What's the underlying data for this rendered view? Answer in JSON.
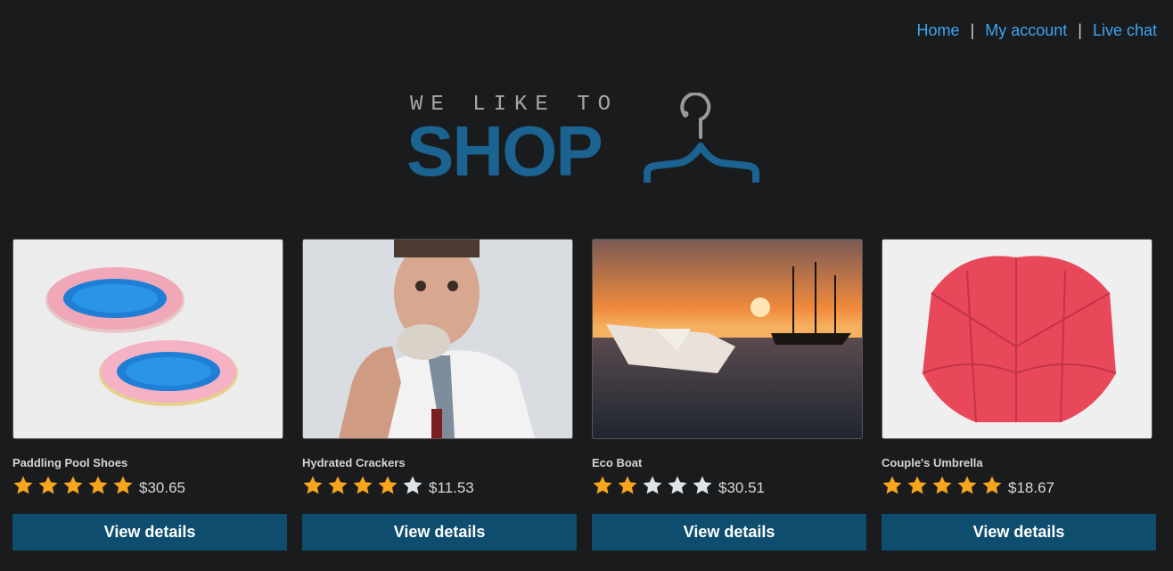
{
  "nav": {
    "home": "Home",
    "account": "My account",
    "chat": "Live chat",
    "sep": "|"
  },
  "logo": {
    "tagline": "WE LIKE TO",
    "word": "SHOP",
    "icon": "hanger-icon"
  },
  "colors": {
    "background": "#1a1b1d",
    "link": "#3da5f0",
    "button": "#0e4d6e",
    "brand": "#1b6391",
    "star_filled": "#f6a51c",
    "star_empty": "#dfe4e8"
  },
  "products": [
    {
      "name": "Paddling Pool Shoes",
      "rating": 5,
      "price": "$30.65",
      "button": "View details",
      "image": "paddling-pool-image"
    },
    {
      "name": "Hydrated Crackers",
      "rating": 4,
      "price": "$11.53",
      "button": "View details",
      "image": "man-eating-cracker-image"
    },
    {
      "name": "Eco Boat",
      "rating": 2,
      "price": "$30.51",
      "button": "View details",
      "image": "paper-boat-sea-image"
    },
    {
      "name": "Couple's Umbrella",
      "rating": 5,
      "price": "$18.67",
      "button": "View details",
      "image": "red-umbrella-image"
    }
  ]
}
